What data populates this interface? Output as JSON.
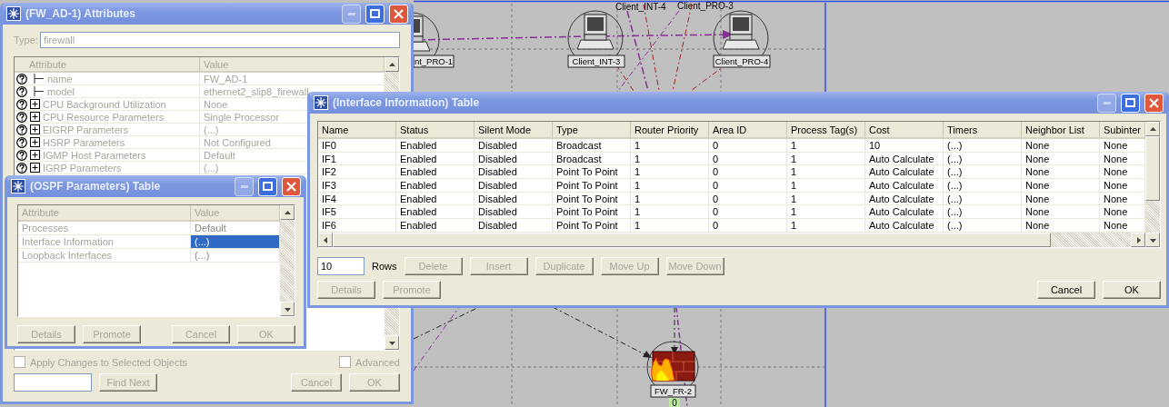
{
  "canvas": {
    "nodes": [
      {
        "kind": "pc",
        "label": "nt_PRO-1"
      },
      {
        "kind": "pc",
        "label": "Client_INT-3"
      },
      {
        "kind": "pc",
        "label": "Client_PRO-4"
      },
      {
        "kind": "firewall",
        "label": "FW_FR-2"
      }
    ],
    "floating_labels": [
      "Client_INT-4",
      "Client_PRO-3"
    ],
    "badge": "0"
  },
  "attributes_window": {
    "title": "(FW_AD-1) Attributes",
    "type_label": "Type:",
    "type_value": "firewall",
    "columns": [
      "Attribute",
      "Value"
    ],
    "rows": [
      {
        "kind": "leaf",
        "attribute": "name",
        "value": "FW_AD-1"
      },
      {
        "kind": "leaf",
        "attribute": "model",
        "value": "ethernet2_slip8_firewall"
      },
      {
        "kind": "group",
        "attribute": "CPU Background Utilization",
        "value": "None"
      },
      {
        "kind": "group",
        "attribute": "CPU Resource Parameters",
        "value": "Single Processor"
      },
      {
        "kind": "group",
        "attribute": "EIGRP Parameters",
        "value": "(...)"
      },
      {
        "kind": "group",
        "attribute": "HSRP Parameters",
        "value": "Not Configured"
      },
      {
        "kind": "group",
        "attribute": "IGMP Host Parameters",
        "value": "Default"
      },
      {
        "kind": "group",
        "attribute": "IGRP Parameters",
        "value": "(...)"
      }
    ],
    "apply_changes": {
      "label": "Apply Changes to Selected Objects",
      "checked": false
    },
    "advanced": {
      "label": "Advanced",
      "checked": false
    },
    "buttons": [
      {
        "label": "Find Next",
        "disabled": true
      },
      {
        "label": "Cancel",
        "disabled": true
      },
      {
        "label": "OK",
        "disabled": true
      }
    ]
  },
  "ospf_window": {
    "title": "(OSPF Parameters) Table",
    "columns": [
      "Attribute",
      "Value"
    ],
    "rows": [
      {
        "attribute": "Processes",
        "value": "Default",
        "selected": false
      },
      {
        "attribute": "Interface Information",
        "value": "(...)",
        "selected": true
      },
      {
        "attribute": "Loopback Interfaces",
        "value": "(...)",
        "selected": false
      }
    ],
    "buttons": [
      {
        "label": "Details",
        "disabled": true
      },
      {
        "label": "Promote",
        "disabled": true
      },
      {
        "label": "Cancel",
        "disabled": true
      },
      {
        "label": "OK",
        "disabled": true
      }
    ]
  },
  "interface_window": {
    "title": "(Interface Information) Table",
    "columns": [
      "Name",
      "Status",
      "Silent Mode",
      "Type",
      "Router Priority",
      "Area ID",
      "Process Tag(s)",
      "Cost",
      "Timers",
      "Neighbor List",
      "Subinter"
    ],
    "rows": [
      [
        "IF0",
        "Enabled",
        "Disabled",
        "Broadcast",
        "1",
        "0",
        "1",
        "10",
        "(...)",
        "None",
        "None"
      ],
      [
        "IF1",
        "Enabled",
        "Disabled",
        "Broadcast",
        "1",
        "0",
        "1",
        "Auto Calculate",
        "(...)",
        "None",
        "None"
      ],
      [
        "IF2",
        "Enabled",
        "Disabled",
        "Point To Point",
        "1",
        "0",
        "1",
        "Auto Calculate",
        "(...)",
        "None",
        "None"
      ],
      [
        "IF3",
        "Enabled",
        "Disabled",
        "Point To Point",
        "1",
        "0",
        "1",
        "Auto Calculate",
        "(...)",
        "None",
        "None"
      ],
      [
        "IF4",
        "Enabled",
        "Disabled",
        "Point To Point",
        "1",
        "0",
        "1",
        "Auto Calculate",
        "(...)",
        "None",
        "None"
      ],
      [
        "IF5",
        "Enabled",
        "Disabled",
        "Point To Point",
        "1",
        "0",
        "1",
        "Auto Calculate",
        "(...)",
        "None",
        "None"
      ],
      [
        "IF6",
        "Enabled",
        "Disabled",
        "Point To Point",
        "1",
        "0",
        "1",
        "Auto Calculate",
        "(...)",
        "None",
        "None"
      ]
    ],
    "rows_count": "10",
    "rows_label": "Rows",
    "edit_buttons": [
      {
        "label": "Delete",
        "disabled": true
      },
      {
        "label": "Insert",
        "disabled": true
      },
      {
        "label": "Duplicate",
        "disabled": true
      },
      {
        "label": "Move Up",
        "disabled": true
      },
      {
        "label": "Move Down",
        "disabled": true
      }
    ],
    "left_buttons": [
      {
        "label": "Details",
        "disabled": true
      },
      {
        "label": "Promote",
        "disabled": true
      }
    ],
    "right_buttons": [
      {
        "label": "Cancel",
        "disabled": false
      },
      {
        "label": "OK",
        "disabled": false
      }
    ]
  }
}
